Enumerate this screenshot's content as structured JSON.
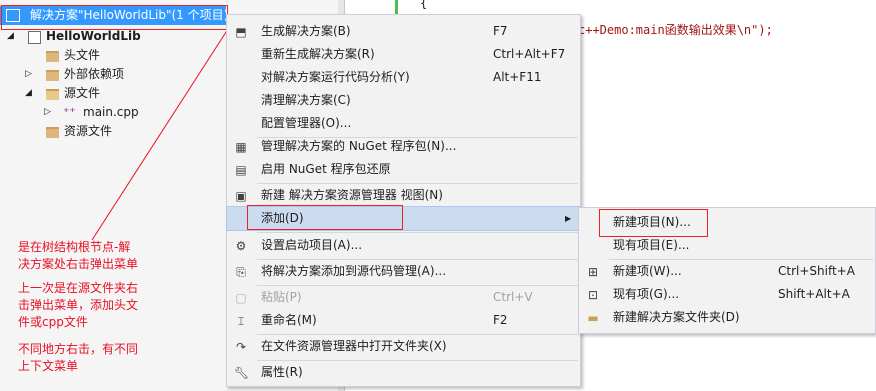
{
  "explorer": {
    "solution_label": "解决方案\"HelloWorldLib\"(1 个项目)",
    "project_label": "HelloWorldLib",
    "items": [
      {
        "label": "头文件"
      },
      {
        "label": "外部依赖项"
      },
      {
        "label": "源文件"
      },
      {
        "label": "main.cpp"
      },
      {
        "label": "资源文件"
      }
    ]
  },
  "code": {
    "line1": "{",
    "line2_pre": "c++Demo:main函数输出效果\\n\");"
  },
  "annotations": {
    "note1": [
      "是在树结构根节点-解",
      "决方案处右击弹出菜单"
    ],
    "note2": [
      "上一次是在源文件夹右",
      "击弹出菜单，添加头文",
      "件或cpp文件"
    ],
    "note3": [
      "不同地方右击，有不同",
      "上下文菜单"
    ]
  },
  "context_menu": {
    "items": [
      {
        "label": "生成解决方案(B)",
        "shortcut": "F7",
        "icon": "build-icon"
      },
      {
        "label": "重新生成解决方案(R)",
        "shortcut": "Ctrl+Alt+F7",
        "icon": ""
      },
      {
        "label": "对解决方案运行代码分析(Y)",
        "shortcut": "Alt+F11",
        "icon": ""
      },
      {
        "label": "清理解决方案(C)",
        "shortcut": "",
        "icon": ""
      },
      {
        "label": "配置管理器(O)...",
        "shortcut": "",
        "icon": ""
      },
      {
        "label": "管理解决方案的 NuGet 程序包(N)...",
        "shortcut": "",
        "icon": "nuget-icon"
      },
      {
        "label": "启用 NuGet 程序包还原",
        "shortcut": "",
        "icon": "nuget-restore-icon"
      },
      {
        "label": "新建 解决方案资源管理器 视图(N)",
        "shortcut": "",
        "icon": "new-view-icon"
      },
      {
        "label": "添加(D)",
        "shortcut": "",
        "icon": ""
      },
      {
        "label": "设置启动项目(A)...",
        "shortcut": "",
        "icon": "gear-icon"
      },
      {
        "label": "将解决方案添加到源代码管理(A)...",
        "shortcut": "",
        "icon": "source-control-icon"
      },
      {
        "label": "粘贴(P)",
        "shortcut": "Ctrl+V",
        "icon": "paste-icon"
      },
      {
        "label": "重命名(M)",
        "shortcut": "F2",
        "icon": "rename-icon"
      },
      {
        "label": "在文件资源管理器中打开文件夹(X)",
        "shortcut": "",
        "icon": "open-folder-icon"
      },
      {
        "label": "属性(R)",
        "shortcut": "",
        "icon": "wrench-icon"
      }
    ]
  },
  "submenu": {
    "items": [
      {
        "label": "新建项目(N)...",
        "shortcut": ""
      },
      {
        "label": "现有项目(E)...",
        "shortcut": ""
      },
      {
        "label": "新建项(W)...",
        "shortcut": "Ctrl+Shift+A"
      },
      {
        "label": "现有项(G)...",
        "shortcut": "Shift+Alt+A"
      },
      {
        "label": "新建解决方案文件夹(D)",
        "shortcut": ""
      }
    ]
  }
}
